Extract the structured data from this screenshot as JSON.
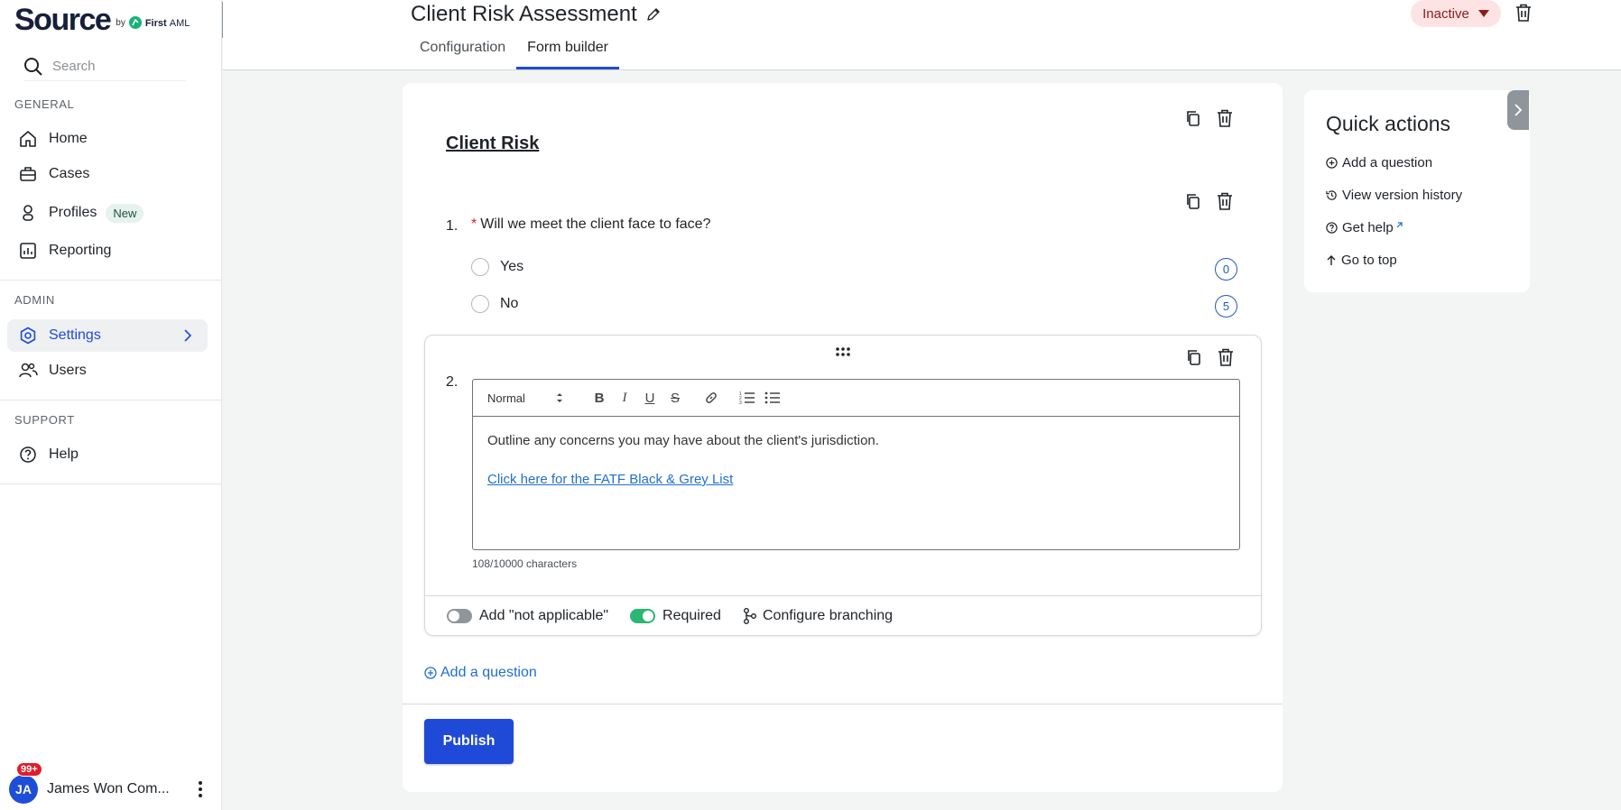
{
  "brand": {
    "name": "Source",
    "by": "by",
    "company": "First",
    "company_suffix": "AML"
  },
  "sidebar": {
    "search_placeholder": "Search",
    "sections": {
      "general": "GENERAL",
      "admin": "ADMIN",
      "support": "SUPPORT"
    },
    "items": [
      {
        "label": "Home",
        "icon": "home-icon"
      },
      {
        "label": "Cases",
        "icon": "briefcase-icon"
      },
      {
        "label": "Profiles",
        "icon": "person-icon",
        "badge": "New"
      },
      {
        "label": "Reporting",
        "icon": "chart-icon"
      },
      {
        "label": "Settings",
        "icon": "gear-icon"
      },
      {
        "label": "Users",
        "icon": "users-icon"
      },
      {
        "label": "Help",
        "icon": "help-icon"
      }
    ],
    "user": {
      "initials": "JA",
      "name": "James Won Com...",
      "notifications": "99+"
    }
  },
  "header": {
    "title": "Client Risk Assessment",
    "tabs": [
      "Configuration",
      "Form builder"
    ],
    "status": "Inactive"
  },
  "form": {
    "section_title": "Client Risk",
    "questions": [
      {
        "number": "1.",
        "required_mark": "*",
        "text": "Will we meet the client face to face?",
        "options": [
          {
            "label": "Yes",
            "score": "0"
          },
          {
            "label": "No",
            "score": "5"
          }
        ]
      },
      {
        "number": "2.",
        "editor": {
          "format": "Normal",
          "body": "Outline any concerns you may have about the client's jurisdiction.",
          "link": "Click here for the FATF Black & Grey List"
        },
        "char_count": "108/10000 characters",
        "footer": {
          "not_applicable": "Add \"not applicable\"",
          "required": "Required",
          "branching": "Configure branching"
        }
      }
    ],
    "add_question": "Add a question",
    "publish": "Publish"
  },
  "quick_actions": {
    "title": "Quick actions",
    "items": [
      "Add a question",
      "View version history",
      "Get help",
      "Go to top"
    ]
  },
  "colors": {
    "accent": "#1f4ad8",
    "link": "#1f6fd0",
    "toggle_on": "#2bb673",
    "status_bg": "#fde3e3"
  }
}
